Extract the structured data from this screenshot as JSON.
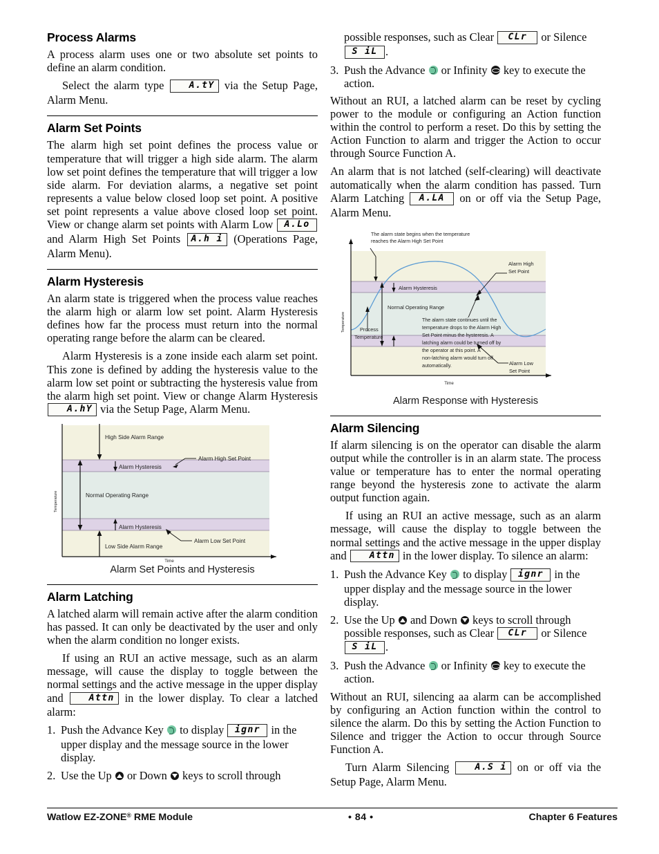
{
  "document": {
    "footer": {
      "left_prefix": "Watlow EZ-ZONE",
      "left_reg": "®",
      "left_suffix": " RME Module",
      "center": "•  84  •",
      "right": "Chapter 6 Features"
    }
  },
  "left_column": {
    "process_alarms": {
      "heading": "Process Alarms",
      "p1": "A process alarm uses one or two absolute set points to define an alarm condition.",
      "p2_before": "Select the alarm type",
      "p2_led": "A.tY",
      "p2_after": "via the Setup Page, Alarm Menu."
    },
    "alarm_set_points": {
      "heading": "Alarm Set Points",
      "p1_a": "The alarm high set point defines the process value or temperature that will trigger a high side alarm. The alarm low set point defines the temperature that will trigger a low side alarm. For deviation alarms, a negative set point represents a value below closed loop set point. A positive set point represents a value above closed loop set point. View or change alarm set points with Alarm Low",
      "led_alo": "A.Lo",
      "p1_b": "and Alarm High Set Points",
      "led_ahi": "A.h i",
      "p1_c": "(Operations Page, Alarm Menu)."
    },
    "alarm_hysteresis": {
      "heading": "Alarm Hysteresis",
      "p1": "An alarm state is triggered when the process value reaches the alarm high or alarm low set point. Alarm Hysteresis defines how far the process must return into the normal operating range before the alarm can be cleared.",
      "p2_a": "Alarm Hysteresis is a zone inside each alarm set point. This zone is defined by adding the hysteresis value to the alarm low set point or subtracting the hysteresis value from the alarm high set point. View or change Alarm Hysteresis",
      "led_ahy": "A.hY",
      "p2_b": "via the Setup Page, Alarm Menu."
    },
    "alarm_latching": {
      "heading": "Alarm Latching",
      "p1": "A latched alarm will remain active after the alarm condition has passed. It can only be deactivated by the user and only when the alarm condition no longer exists.",
      "p2_a": "If using an RUI an active message, such as an alarm message, will cause the display to toggle between the normal settings and the active message in the upper display and",
      "led_attn": "Attn",
      "p2_b": "in the lower display. To clear a latched alarm:",
      "steps": [
        {
          "num": "1.",
          "a": "Push the Advance Key",
          "icon": "advance-key-icon",
          "b": "to display",
          "led": "ignr",
          "c": "in the upper display and the message source in the lower display."
        },
        {
          "num": "2.",
          "a": "Use the Up",
          "icon_up": "up-key-icon",
          "b": "or Down",
          "icon_down": "down-key-icon",
          "c": "keys to scroll through"
        }
      ]
    }
  },
  "right_column": {
    "continued_step2": {
      "a": "possible responses, such as Clear",
      "led_clr": "CLr",
      "b": "or Silence",
      "led_sil": "S iL",
      "c": "."
    },
    "step3": {
      "num": "3.",
      "a": "Push the Advance",
      "icon_advance": "advance-key-icon",
      "b": "or Infinity",
      "icon_infinity": "infinity-key-icon",
      "c": "key to execute the action."
    },
    "latching_body": {
      "p1": "Without an RUI, a latched alarm can be reset by cycling power to the module or configuring an Action function within the control to perform a reset. Do this by setting the Action Function to alarm and trigger the Action to occur through Source Function A.",
      "p2_a": "An alarm that is not latched (self-clearing) will deactivate automatically when the alarm condition has passed. Turn Alarm Latching",
      "led_ala": "A.LA",
      "p2_b": "on or off  via the Setup Page, Alarm Menu."
    },
    "alarm_silencing": {
      "heading": "Alarm Silencing",
      "p1": "If alarm silencing is on the operator can disable the alarm output while the controller is in an alarm state. The process value or temperature has to enter the normal operating range beyond the hysteresis zone to activate the alarm output function again.",
      "p2_a": "If using an RUI an active message, such as an alarm message, will cause the display to toggle between the normal settings and the active message in the upper display and",
      "led_attn": "Attn",
      "p2_b": "in the lower display. To silence an alarm:",
      "steps": [
        {
          "num": "1.",
          "a": "Push the Advance Key",
          "b": "to display",
          "led": "ignr",
          "c": "in the upper display and the message source in the lower display."
        },
        {
          "num": "2.",
          "a": "Use the Up",
          "b": "and Down",
          "c": "keys to scroll through possible responses, such as Clear",
          "led_clr": "CLr",
          "d": "or Silence",
          "led_sil": "S iL",
          "e": "."
        },
        {
          "num": "3.",
          "a": "Push the Advance",
          "b": "or Infinity",
          "c": "key to execute the action."
        }
      ],
      "p3": "Without an RUI, silencing aa alarm can be accomplished by configuring an Action function within the control to silence the alarm. Do this by setting the Action Function to Silence and trigger the Action to occur through Source Function A.",
      "p4_a": "Turn Alarm Silencing",
      "led_asi": "A.S i",
      "p4_b": "on or off via the Setup Page, Alarm Menu."
    }
  },
  "figure_set_points": {
    "caption": "Alarm Set Points and Hysteresis",
    "axis_y": "Temperature",
    "axis_x": "Time",
    "labels": {
      "high_side": "High Side Alarm Range",
      "alarm_high_sp": "Alarm High Set Point",
      "hysteresis_top": "Alarm Hysteresis",
      "normal_range": "Normal Operating Range",
      "hysteresis_bottom": "Alarm Hysteresis",
      "alarm_low_sp": "Alarm Low Set Point",
      "low_side": "Low Side Alarm Range"
    },
    "colors": {
      "alarm_band": "#f3f2e0",
      "hysteresis_band": "#ded3e6",
      "normal_band": "#e3ece8",
      "outline": "#111111"
    }
  },
  "figure_response": {
    "caption": "Alarm Response with Hysteresis",
    "axis_y": "Temperature",
    "axis_x": "Time",
    "labels": {
      "begin_note": "The alarm state begins when the temperature reaches the Alarm High Set Point",
      "alarm_high_sp": "Alarm High Set Point",
      "hysteresis": "Alarm Hysteresis",
      "normal_range": "Normal Operating Range",
      "process_temperature": "Process Temperature",
      "continue_note": "The alarm state continues until the temperature drops to the Alarm High Set Point minus the hysteresis. A latching alarm could be turned off by the operator at this point. A non-latching alarm would turn off automatically.",
      "alarm_low_sp": "Alarm Low Set Point"
    },
    "colors": {
      "alarm_band": "#f3f2e0",
      "hysteresis_band": "#ded3e6",
      "normal_band": "#e3ece8",
      "curve": "#5a9bd4",
      "outline": "#111111"
    }
  }
}
